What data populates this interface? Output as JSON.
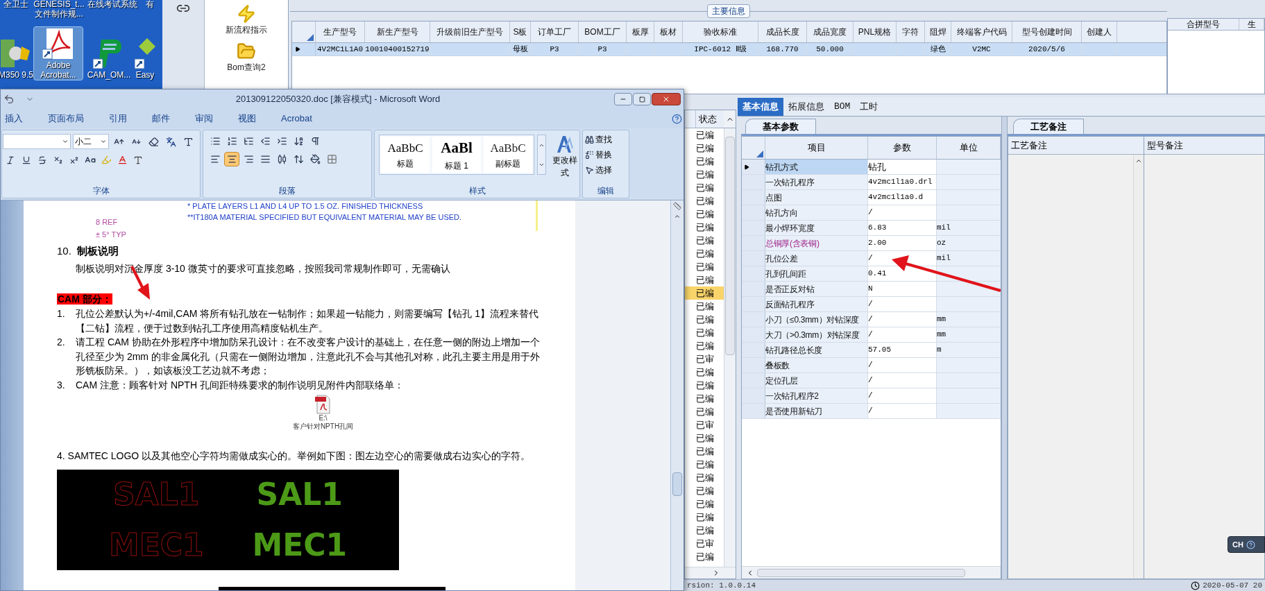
{
  "desktop": {
    "rows": [
      {
        "icons": [
          {
            "lines": [
              "全卫士"
            ],
            "selected": false,
            "kind": "none"
          },
          {
            "lines": [
              "GENESIS_t...",
              "文件制作规..."
            ],
            "selected": false,
            "kind": "none"
          },
          {
            "lines": [
              "在线考试系统"
            ],
            "selected": false,
            "kind": "none"
          },
          {
            "lines": [
              "有"
            ],
            "selected": false,
            "kind": "none"
          }
        ]
      },
      {
        "icons": [
          {
            "lines": [
              "M350 9.5"
            ],
            "selected": false,
            "kind": "chip"
          },
          {
            "lines": [
              "Adobe",
              "Acrobat..."
            ],
            "selected": true,
            "kind": "acrobat"
          },
          {
            "lines": [
              "CAM_OM..."
            ],
            "selected": false,
            "kind": "letter-p"
          },
          {
            "lines": [
              "Easy"
            ],
            "selected": false,
            "kind": "diamond"
          }
        ]
      }
    ]
  },
  "toolbar": {
    "items": [
      {
        "label": "新流程指示",
        "kind": "flow"
      },
      {
        "label": "Bom查询2",
        "kind": "folder"
      }
    ]
  },
  "main_info": {
    "title": "主要信息",
    "columns": [
      "生产型号",
      "新生产型号",
      "升级前旧生产型号",
      "S板",
      "订单工厂",
      "BOM工厂",
      "板厚",
      "板材",
      "验收标准",
      "成品长度",
      "成品宽度",
      "PNL规格",
      "字符",
      "阻焊",
      "终端客户代码",
      "型号创建时间",
      "创建人"
    ],
    "rows": [
      {
        "selected": true,
        "cells": [
          "4V2MC1L1A0",
          "10010400152719",
          null,
          "母板",
          "P3",
          "P3",
          null,
          null,
          "IPC-6012 Ⅱ级",
          "168.770",
          "50.000",
          null,
          null,
          "绿色",
          "V2MC",
          "2020/5/6",
          null
        ]
      }
    ]
  },
  "merge_table": {
    "columns": [
      "合拼型号",
      "生"
    ]
  },
  "status_list": {
    "header": "状态",
    "items": [
      {
        "label": "已编",
        "selected": false
      },
      {
        "label": "已编",
        "selected": false
      },
      {
        "label": "已编",
        "selected": false
      },
      {
        "label": "已编",
        "selected": false
      },
      {
        "label": "已编",
        "selected": false
      },
      {
        "label": "已编",
        "selected": false
      },
      {
        "label": "已编",
        "selected": false
      },
      {
        "label": "已编",
        "selected": false
      },
      {
        "label": "已编",
        "selected": false
      },
      {
        "label": "已编",
        "selected": false
      },
      {
        "label": "已编",
        "selected": false
      },
      {
        "label": "已编",
        "selected": false
      },
      {
        "label": "已编",
        "selected": true
      },
      {
        "label": "已编",
        "selected": false
      },
      {
        "label": "已编",
        "selected": false
      },
      {
        "label": "已编",
        "selected": false
      },
      {
        "label": "已编",
        "selected": false
      },
      {
        "label": "已审",
        "selected": false
      },
      {
        "label": "已编",
        "selected": false
      },
      {
        "label": "已编",
        "selected": false
      },
      {
        "label": "已编",
        "selected": false
      },
      {
        "label": "已编",
        "selected": false
      },
      {
        "label": "已审",
        "selected": false
      },
      {
        "label": "已编",
        "selected": false
      },
      {
        "label": "已编",
        "selected": false
      },
      {
        "label": "已编",
        "selected": false
      },
      {
        "label": "已编",
        "selected": false
      },
      {
        "label": "已编",
        "selected": false
      },
      {
        "label": "已编",
        "selected": false
      },
      {
        "label": "已编",
        "selected": false
      },
      {
        "label": "已编",
        "selected": false
      },
      {
        "label": "已审",
        "selected": false
      },
      {
        "label": "已编",
        "selected": false
      }
    ]
  },
  "detail_tabs": [
    {
      "label": "基本信息",
      "selected": true
    },
    {
      "label": "拓展信息",
      "selected": false
    },
    {
      "label": "BOM",
      "selected": false
    },
    {
      "label": "工时",
      "selected": false
    }
  ],
  "params": {
    "tab": "基本参数",
    "columns": [
      "项目",
      "参数",
      "单位"
    ],
    "rows": [
      {
        "item": "钻孔方式",
        "value": "钻孔",
        "selected": true,
        "flagged": false
      },
      {
        "item": "一次钻孔程序",
        "value": "4v2mc1l1a0.drl",
        "selected": false,
        "flagged": false
      },
      {
        "item": "点图",
        "value": "4v2mc1l1a0.d",
        "selected": false,
        "flagged": false
      },
      {
        "item": "钻孔方向",
        "value": "/",
        "selected": false,
        "flagged": false
      },
      {
        "item": "最小焊环宽度",
        "value": "6.83",
        "unit": "mil",
        "selected": false,
        "flagged": false
      },
      {
        "item": "总铜厚(含表铜)",
        "value": "2.00",
        "unit": "oz",
        "selected": false,
        "flagged": true
      },
      {
        "item": "孔位公差",
        "value": "/",
        "unit": "mil",
        "selected": false,
        "flagged": false
      },
      {
        "item": "孔到孔间距",
        "value": "0.41",
        "selected": false,
        "flagged": false
      },
      {
        "item": "是否正反对钻",
        "value": "N",
        "selected": false,
        "flagged": false
      },
      {
        "item": "反面钻孔程序",
        "value": "/",
        "selected": false,
        "flagged": false
      },
      {
        "item": "小刀（≤0.3mm）对钻深度",
        "value": "/",
        "unit": "mm",
        "selected": false,
        "flagged": false
      },
      {
        "item": "大刀（>0.3mm）对钻深度",
        "value": "/",
        "unit": "mm",
        "selected": false,
        "flagged": false
      },
      {
        "item": "钻孔路径总长度",
        "value": "57.05",
        "unit": "m",
        "selected": false,
        "flagged": false
      },
      {
        "item": "叠板数",
        "value": "/",
        "selected": false,
        "flagged": false
      },
      {
        "item": "定位孔层",
        "value": "/",
        "selected": false,
        "flagged": false
      },
      {
        "item": "一次钻孔程序2",
        "value": "/",
        "selected": false,
        "flagged": false
      },
      {
        "item": "是否使用新钻刀",
        "value": "/",
        "selected": false,
        "flagged": false
      }
    ]
  },
  "notes": {
    "tab": "工艺备注",
    "columns": [
      "工艺备注",
      "型号备注"
    ]
  },
  "status_bar": {
    "version": "rsion: 1.0.0.14",
    "time": "2020-05-07 20"
  },
  "ime": {
    "label": "CH"
  },
  "word": {
    "title": "201309122050320.doc [兼容模式] - Microsoft Word",
    "tabs": [
      "插入",
      "页面布局",
      "引用",
      "邮件",
      "审阅",
      "视图",
      "Acrobat"
    ],
    "font_size": "小二",
    "groups": [
      "字体",
      "段落",
      "样式",
      "编辑"
    ],
    "align_buttons": [
      {
        "kind": "left",
        "selected": false
      },
      {
        "kind": "center",
        "selected": true
      },
      {
        "kind": "right",
        "selected": false
      },
      {
        "kind": "justify",
        "selected": false
      },
      {
        "kind": "distributed",
        "selected": false
      }
    ],
    "styles": [
      {
        "sample": "AaBbC",
        "label": "标题",
        "kind": "title"
      },
      {
        "sample": "AaBl",
        "label": "标题 1",
        "kind": "heading"
      },
      {
        "sample": "AaBbC",
        "label": "副标题",
        "kind": "subtitle"
      }
    ],
    "change_styles": "更改样式",
    "editing": [
      {
        "label": "查找",
        "kind": "find"
      },
      {
        "label": "替换",
        "kind": "replace"
      },
      {
        "label": "选择",
        "kind": "select"
      }
    ],
    "document": {
      "drawing_labels": [
        "8 REF",
        "± 5° TYP"
      ],
      "drawing_notes": [
        "* PLATE LAYERS L1 AND L4 UP TO 1.5 OZ. FINISHED THICKNESS",
        "**IT180A MATERIAL SPECIFIED BUT EQUIVALENT MATERIAL MAY BE USED."
      ],
      "blocks": [
        {
          "kind": "heading",
          "number": "10.",
          "text": "制板说明"
        },
        {
          "kind": "indented",
          "text": "制板说明对沉金厚度 3-10 微英寸的要求可直接忽略，按照我司常规制作即可，无需确认"
        },
        {
          "kind": "highlight",
          "text": "CAM 部分："
        },
        {
          "kind": "list_item",
          "number": "1.",
          "text": "孔位公差默认为+/-4mil,CAM 将所有钻孔放在一钻制作；如果超一钻能力，则需要编写【钻孔 1】流程来替代【二钻】流程，便于过数到钻孔工序使用高精度钻机生产。"
        },
        {
          "kind": "list_item",
          "number": "2.",
          "text": "请工程 CAM 协助在外形程序中增加防呆孔设计：在不改变客户设计的基础上，在任意一侧的附边上增加一个孔径至少为 2mm 的非金属化孔（只需在一侧附边增加，注意此孔不会与其他孔对称，此孔主要主用是用于外形铣板防呆。），如该板没工艺边就不考虑；"
        },
        {
          "kind": "list_item",
          "number": "3.",
          "text": "CAM 注意：顾客针对 NPTH 孔间距特殊要求的制作说明见附件内部联络单："
        },
        {
          "kind": "attachment",
          "lines": [
            "E:\\",
            "客户针对NPTH孔间"
          ]
        },
        {
          "kind": "paragraph",
          "text": "4. SAMTEC LOGO 以及其他空心字符均需做成实心的。举例如下图：图左边空心的需要做成右边实心的字符。"
        },
        {
          "kind": "logo_image",
          "rows": [
            [
              "SAL1",
              "SAL1"
            ],
            [
              "MEC1",
              "MEC1"
            ]
          ]
        }
      ]
    }
  }
}
